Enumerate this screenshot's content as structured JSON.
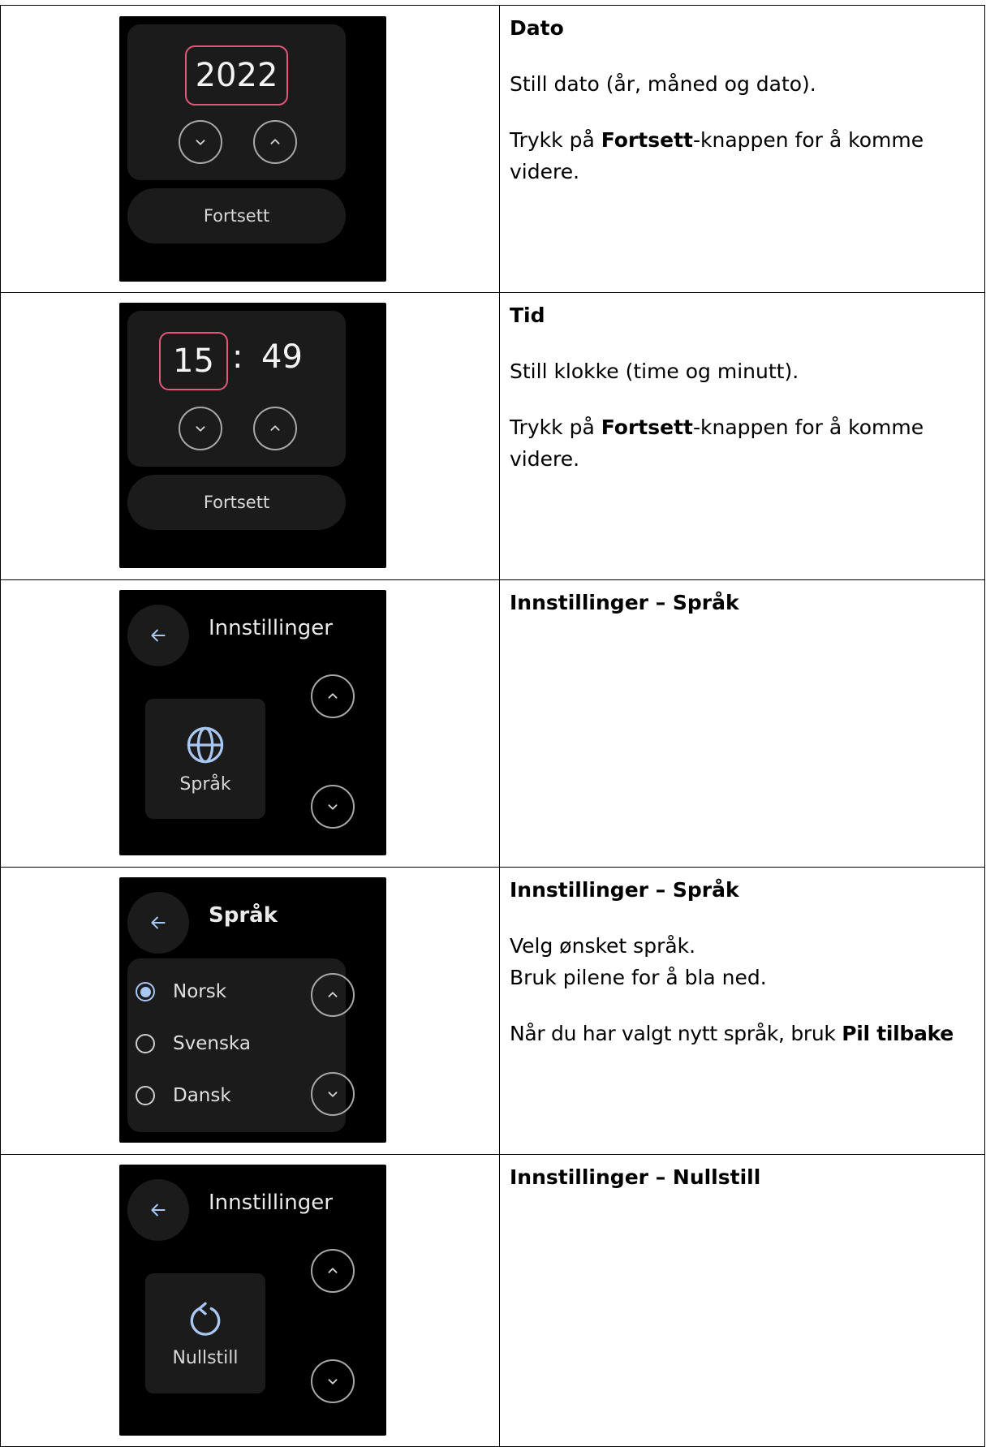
{
  "rows": [
    {
      "screen": {
        "year": "2022",
        "continue_label": "Fortsett"
      },
      "title": "Dato",
      "paragraphs": [
        {
          "text": "Still dato (år, måned og dato)."
        },
        {
          "before": "Trykk på ",
          "bold": "Fortsett",
          "after": "-knappen for å komme videre."
        }
      ]
    },
    {
      "screen": {
        "hour": "15",
        "separator": ":",
        "minute": "49",
        "continue_label": "Fortsett"
      },
      "title": "Tid",
      "paragraphs": [
        {
          "text": "Still klokke (time og minutt)."
        },
        {
          "before": "Trykk på ",
          "bold": "Fortsett",
          "after": "-knappen for å komme videre."
        }
      ]
    },
    {
      "screen": {
        "header": "Innstillinger",
        "tile_label": "Språk",
        "tile_icon": "globe-icon"
      },
      "title": "Innstillinger – Språk"
    },
    {
      "screen": {
        "header": "Språk",
        "options": [
          {
            "label": "Norsk",
            "selected": true
          },
          {
            "label": "Svenska",
            "selected": false
          },
          {
            "label": "Dansk",
            "selected": false
          }
        ]
      },
      "title": "Innstillinger – Språk",
      "paragraphs": [
        {
          "line1": "Velg ønsket språk.",
          "line2": "Bruk pilene for å bla ned."
        },
        {
          "before": "Når du har valgt nytt språk, bruk ",
          "bold": "Pil tilbake"
        }
      ]
    },
    {
      "screen": {
        "header": "Innstillinger",
        "tile_label": "Nullstill",
        "tile_icon": "reset-icon"
      },
      "title": "Innstillinger – Nullstill"
    }
  ],
  "colors": {
    "highlight": "#e4577a",
    "accent": "#a9c7f2",
    "panel": "#1b1b1b",
    "screen": "#000000"
  }
}
